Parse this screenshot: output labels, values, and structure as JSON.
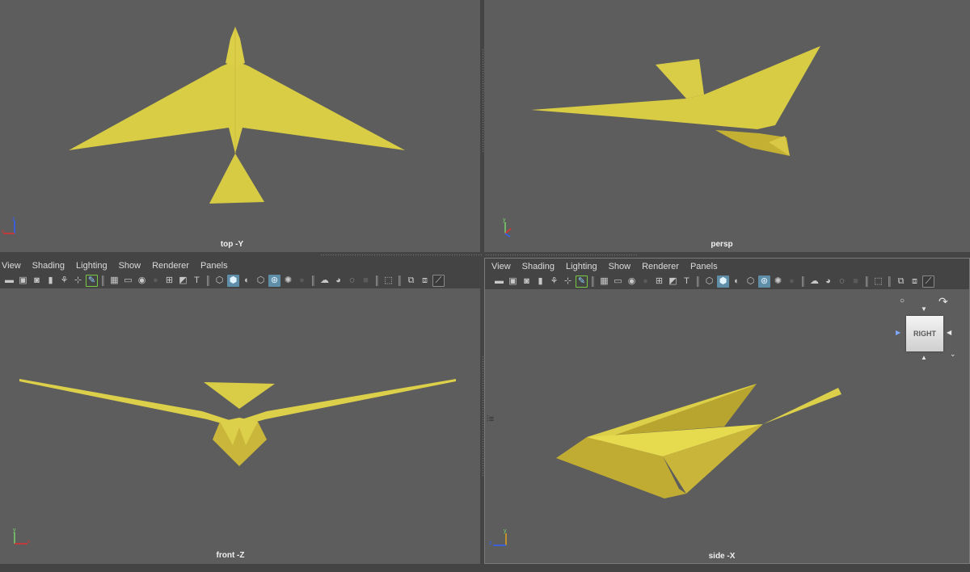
{
  "app": "Maya viewport - four view layout",
  "panels": {
    "top": {
      "label": "top -Y",
      "axis_labels": [
        "z",
        "x",
        "y"
      ]
    },
    "persp": {
      "label": "persp",
      "axis_labels": [
        "y",
        "x",
        "z"
      ]
    },
    "front": {
      "label": "front -Z",
      "axis_labels": [
        "y",
        "x",
        "z"
      ]
    },
    "side": {
      "label": "side -X",
      "axis_labels": [
        "y",
        "z",
        "x"
      ]
    }
  },
  "menu": [
    "View",
    "Shading",
    "Lighting",
    "Show",
    "Renderer",
    "Panels"
  ],
  "toolbar_icons": [
    {
      "icon": "camera-icon",
      "glyph": "▬",
      "state": "normal"
    },
    {
      "icon": "lock-camera-icon",
      "glyph": "▣",
      "state": "normal"
    },
    {
      "icon": "camera-attributes-icon",
      "glyph": "◙",
      "state": "normal"
    },
    {
      "icon": "bookmark-icon",
      "glyph": "▮",
      "state": "normal"
    },
    {
      "icon": "image-plane-icon",
      "glyph": "⚘",
      "state": "normal"
    },
    {
      "icon": "2d-pan-zoom-icon",
      "glyph": "⊹",
      "state": "normal"
    },
    {
      "icon": "grease-pencil-icon",
      "glyph": "✎",
      "state": "green"
    },
    {
      "sep": true
    },
    {
      "icon": "grid-icon",
      "glyph": "▦",
      "state": "normal"
    },
    {
      "icon": "film-gate-icon",
      "glyph": "▭",
      "state": "normal"
    },
    {
      "icon": "resolution-gate-icon",
      "glyph": "◉",
      "state": "normal"
    },
    {
      "icon": "gate-mask-icon",
      "glyph": "●",
      "state": "dim"
    },
    {
      "icon": "field-chart-icon",
      "glyph": "⊞",
      "state": "normal"
    },
    {
      "icon": "safe-action-icon",
      "glyph": "◩",
      "state": "normal"
    },
    {
      "icon": "safe-title-icon",
      "glyph": "T",
      "state": "normal"
    },
    {
      "sep": true
    },
    {
      "icon": "wireframe-icon",
      "glyph": "⬡",
      "state": "normal"
    },
    {
      "icon": "smooth-shade-icon",
      "glyph": "⬢",
      "state": "active"
    },
    {
      "icon": "default-material-icon",
      "glyph": "◐",
      "state": "normal"
    },
    {
      "icon": "shaded-wireframe-icon",
      "glyph": "⬡",
      "state": "normal"
    },
    {
      "icon": "textured-icon",
      "glyph": "⊛",
      "state": "active"
    },
    {
      "icon": "lights-icon",
      "glyph": "✺",
      "state": "normal"
    },
    {
      "icon": "shadows-icon",
      "glyph": "●",
      "state": "dim"
    },
    {
      "sep": true
    },
    {
      "icon": "ambient-occlusion-icon",
      "glyph": "☁",
      "state": "normal"
    },
    {
      "icon": "motion-blur-icon",
      "glyph": "◕",
      "state": "normal"
    },
    {
      "icon": "anti-aliasing-icon",
      "glyph": "◌",
      "state": "normal"
    },
    {
      "icon": "depth-of-field-icon",
      "glyph": "■",
      "state": "dim"
    },
    {
      "sep": true
    },
    {
      "icon": "isolate-select-icon",
      "glyph": "⬚",
      "state": "normal"
    },
    {
      "sep": true
    },
    {
      "icon": "xray-icon",
      "glyph": "⧉",
      "state": "normal"
    },
    {
      "icon": "xray-joints-icon",
      "glyph": "⧈",
      "state": "normal"
    },
    {
      "icon": "xray-active-components-icon",
      "glyph": "⟋",
      "state": "framed"
    }
  ],
  "viewcube": {
    "face_label": "RIGHT"
  },
  "model_color": "#d9cc45"
}
